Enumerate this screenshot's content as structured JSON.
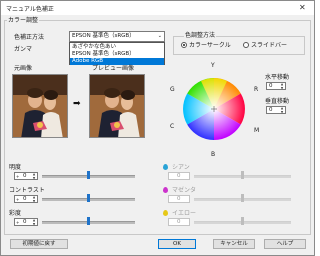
{
  "window": {
    "title": "マニュアル色補正",
    "close_glyph": "✕"
  },
  "color_adjust": {
    "group_label": "カラー調整"
  },
  "correction_method": {
    "label": "色補正方法",
    "selected": "EPSON 基準色（sRGB）",
    "options": [
      "あざやかな色あい",
      "EPSON 基準色（sRGB）",
      "Adobe RGB"
    ],
    "highlighted": "Adobe RGB"
  },
  "gamma": {
    "label": "ガンマ"
  },
  "adjust_method": {
    "group_label": "色調整方法",
    "options": [
      {
        "label": "カラーサークル",
        "checked": true
      },
      {
        "label": "スライドバー",
        "checked": false
      }
    ]
  },
  "preview": {
    "original_label": "元画像",
    "preview_label": "プレビュー画像",
    "arrow": "➡"
  },
  "color_circle": {
    "labels": {
      "top": "Y",
      "left_top": "G",
      "right_top": "R",
      "left_bottom": "C",
      "right_bottom": "M",
      "bottom": "B"
    }
  },
  "shift": {
    "horizontal": {
      "label": "水平移動",
      "value": "0"
    },
    "vertical": {
      "label": "垂直移動",
      "value": "0"
    }
  },
  "sliders_left": [
    {
      "label": "明度",
      "value": "0",
      "position": 0.5
    },
    {
      "label": "コントラスト",
      "value": "0",
      "position": 0.5
    },
    {
      "label": "彩度",
      "value": "0",
      "position": 0.5
    }
  ],
  "sliders_right": [
    {
      "label": "シアン",
      "value": "0",
      "color": "#29a3d6",
      "position": 0.5
    },
    {
      "label": "マゼンタ",
      "value": "0",
      "color": "#cc33cc",
      "position": 0.5
    },
    {
      "label": "イエロー",
      "value": "0",
      "color": "#e6c817",
      "position": 0.5
    }
  ],
  "buttons": {
    "reset": "初期値に戻す",
    "ok": "OK",
    "cancel": "キャンセル",
    "help": "ヘルプ"
  },
  "colors": {
    "accent": "#0078d7",
    "thumb": "#1f73c9"
  }
}
